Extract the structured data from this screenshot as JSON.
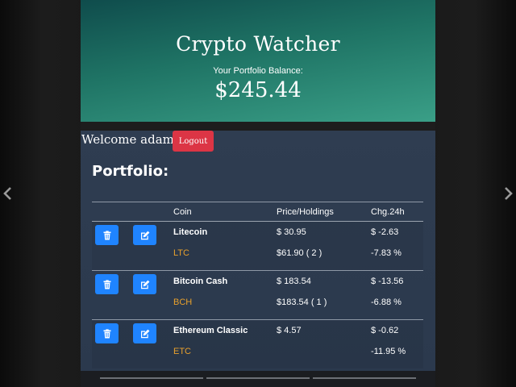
{
  "hero": {
    "title": "Crypto Watcher",
    "balance_label": "Your Portfolio Balance:",
    "balance_value": "$245.44"
  },
  "user": {
    "welcome": "Welcome adam",
    "logout_label": "Logout"
  },
  "portfolio": {
    "title": "Portfolio:",
    "columns": [
      "",
      "",
      "Coin",
      "Price/Holdings",
      "Chg.24h"
    ],
    "rows": [
      {
        "name": "Litecoin",
        "ticker": "LTC",
        "price": "$ 30.95",
        "holdings": "$61.90 ( 2 )",
        "chg_abs": "$ -2.63",
        "chg_pct": "-7.83 %"
      },
      {
        "name": "Bitcoin Cash",
        "ticker": "BCH",
        "price": "$ 183.54",
        "holdings": "$183.54 ( 1 )",
        "chg_abs": "$ -13.56",
        "chg_pct": "-6.88 %"
      },
      {
        "name": "Ethereum Classic",
        "ticker": "ETC",
        "price": "$ 4.57",
        "holdings": "",
        "chg_abs": "$ -0.62",
        "chg_pct": "-11.95 %"
      }
    ]
  },
  "icons": {
    "delete": "trash-icon",
    "edit": "edit-icon",
    "prev": "chevron-left-icon",
    "next": "chevron-right-icon"
  },
  "colors": {
    "delete_button": "#1f84ff",
    "edit_button": "#1f84ff",
    "logout_button": "#dc3545",
    "ticker": "#e8a02c",
    "panel_background": "#2f3d51"
  }
}
